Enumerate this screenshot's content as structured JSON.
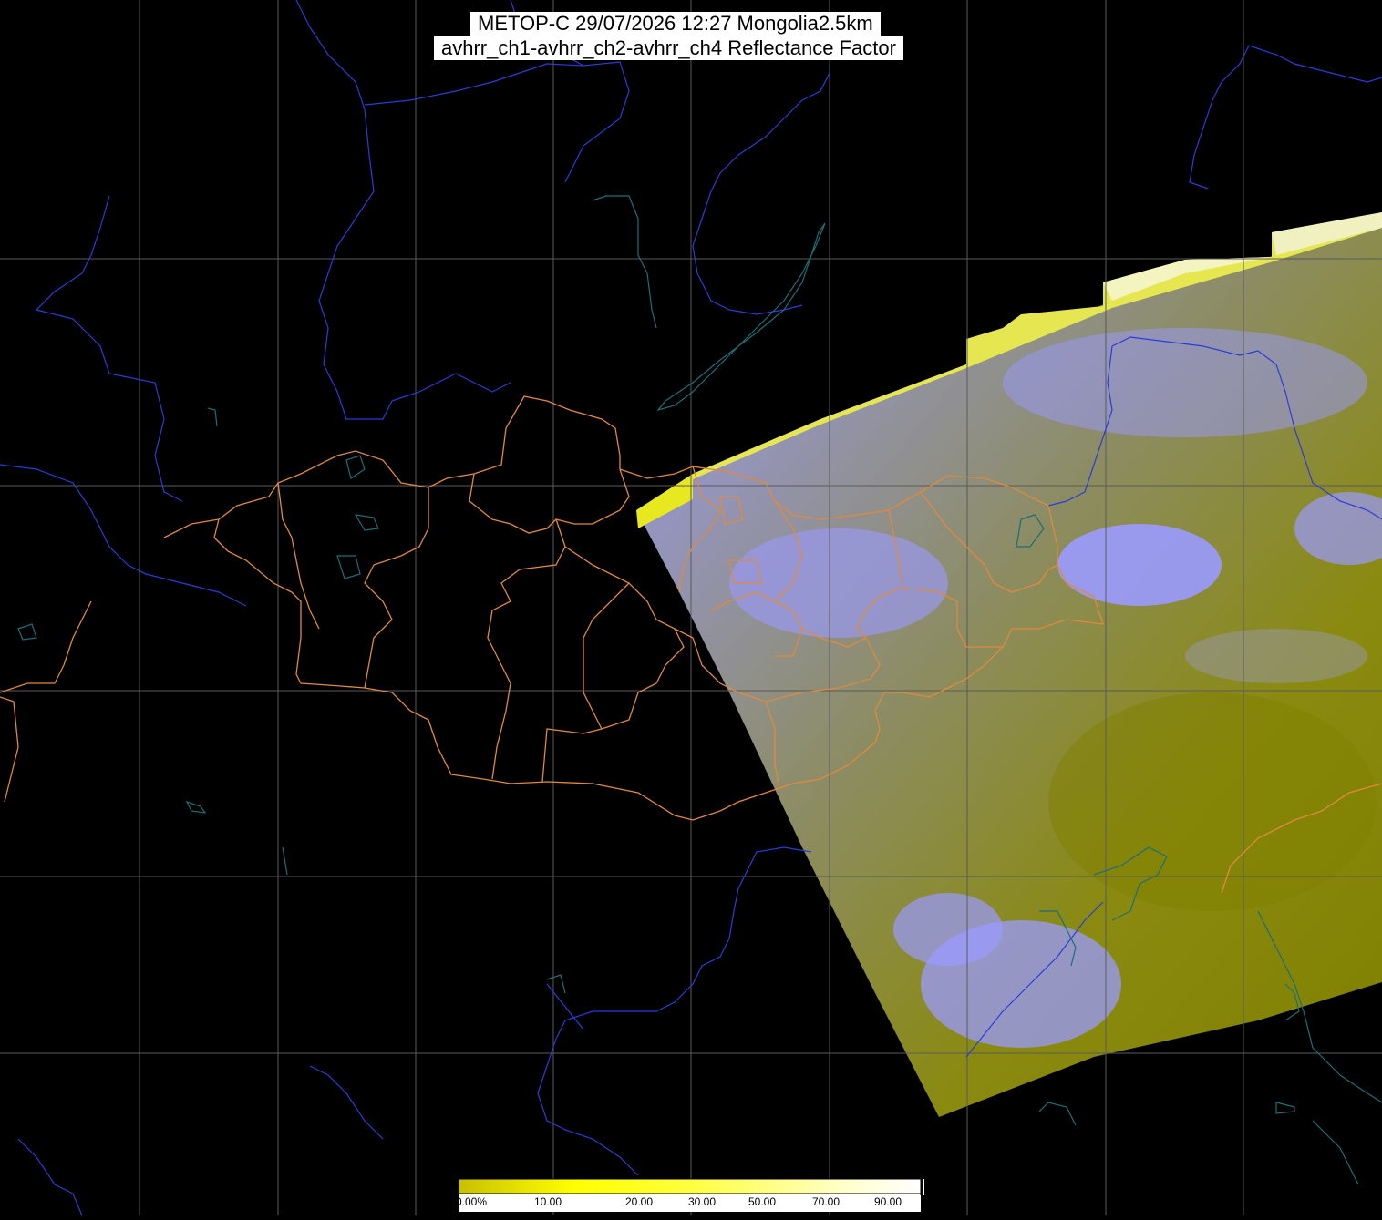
{
  "title": {
    "line1": "METOP-C 29/07/2026 12:27 Mongolia2.5km",
    "line2": "avhrr_ch1-avhrr_ch2-avhrr_ch4 Reflectance Factor"
  },
  "colorbar": {
    "ticks": [
      "0.00%",
      "10.00",
      "20.00",
      "30.00",
      "50.00",
      "70.00",
      "90.00"
    ],
    "colors": [
      "#c8c000",
      "#ffff00",
      "#ffff60",
      "#ffffa0",
      "#ffffd0",
      "#ffffff"
    ]
  },
  "colors": {
    "background": "#000000",
    "graticule": "#5a5a5a",
    "rivers": "#2a3cd8",
    "coast": "#1e6e78",
    "borders": "#e08a3c",
    "clouds": "#8a8aff",
    "ground": "#8a8a00"
  }
}
